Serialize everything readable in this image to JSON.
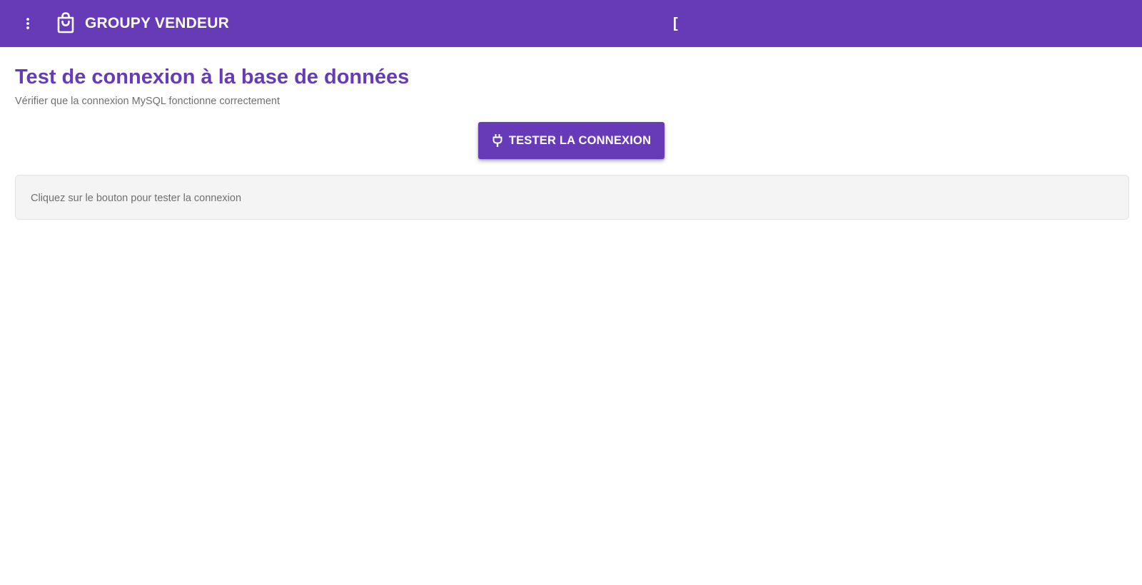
{
  "header": {
    "menu_icon": "more-vert-icon",
    "brand_icon": "shopping-bag-icon",
    "title": "GROUPY VENDEUR",
    "bracket_text": "[",
    "background_color": "#673ab7",
    "text_color": "#ffffff"
  },
  "main": {
    "title": "Test de connexion à la base de données",
    "subtitle": "Vérifier que la connexion MySQL fonctionne correctement",
    "test_button": {
      "label": "TESTER LA CONNEXION",
      "icon": "plug-icon",
      "color": "#673ab7"
    },
    "result_message": "Cliquez sur le bouton pour tester la connexion"
  },
  "colors": {
    "accent": "#673ab7",
    "muted_text": "#6f6f6f",
    "panel_background": "#f4f4f4"
  }
}
